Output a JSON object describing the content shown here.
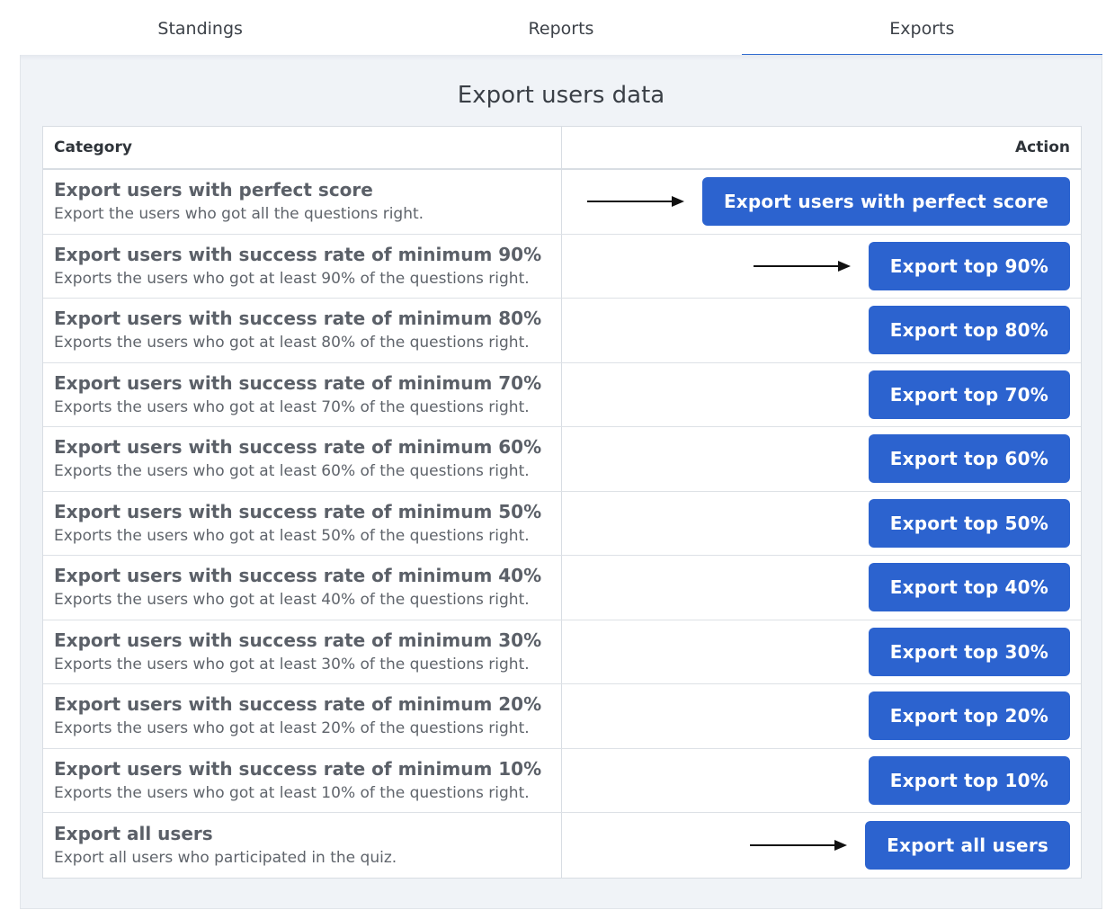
{
  "tabs": [
    {
      "label": "Standings",
      "active": false
    },
    {
      "label": "Reports",
      "active": false
    },
    {
      "label": "Exports",
      "active": true
    }
  ],
  "panel": {
    "title": "Export users data"
  },
  "table": {
    "headers": {
      "category": "Category",
      "action": "Action"
    },
    "rows": [
      {
        "title": "Export users with perfect score",
        "description": "Export the users who got all the questions right.",
        "button": "Export users with perfect score",
        "arrow": true
      },
      {
        "title": "Export users with success rate of minimum 90%",
        "description": "Exports the users who got at least 90% of the questions right.",
        "button": "Export top 90%",
        "arrow": true
      },
      {
        "title": "Export users with success rate of minimum 80%",
        "description": "Exports the users who got at least 80% of the questions right.",
        "button": "Export top 80%",
        "arrow": false
      },
      {
        "title": "Export users with success rate of minimum 70%",
        "description": "Exports the users who got at least 70% of the questions right.",
        "button": "Export top 70%",
        "arrow": false
      },
      {
        "title": "Export users with success rate of minimum 60%",
        "description": "Exports the users who got at least 60% of the questions right.",
        "button": "Export top 60%",
        "arrow": false
      },
      {
        "title": "Export users with success rate of minimum 50%",
        "description": "Exports the users who got at least 50% of the questions right.",
        "button": "Export top 50%",
        "arrow": false
      },
      {
        "title": "Export users with success rate of minimum 40%",
        "description": "Exports the users who got at least 40% of the questions right.",
        "button": "Export top 40%",
        "arrow": false
      },
      {
        "title": "Export users with success rate of minimum 30%",
        "description": "Exports the users who got at least 30% of the questions right.",
        "button": "Export top 30%",
        "arrow": false
      },
      {
        "title": "Export users with success rate of minimum 20%",
        "description": "Exports the users who got at least 20% of the questions right.",
        "button": "Export top 20%",
        "arrow": false
      },
      {
        "title": "Export users with success rate of minimum 10%",
        "description": "Exports the users who got at least 10% of the questions right.",
        "button": "Export top 10%",
        "arrow": false
      },
      {
        "title": "Export all users",
        "description": "Export all users who participated in the quiz.",
        "button": "Export all users",
        "arrow": true
      }
    ]
  },
  "colors": {
    "accent": "#2c63cf",
    "panel_bg": "#f0f3f7"
  },
  "icons": {
    "annotation_arrow": "arrow-right-icon"
  }
}
